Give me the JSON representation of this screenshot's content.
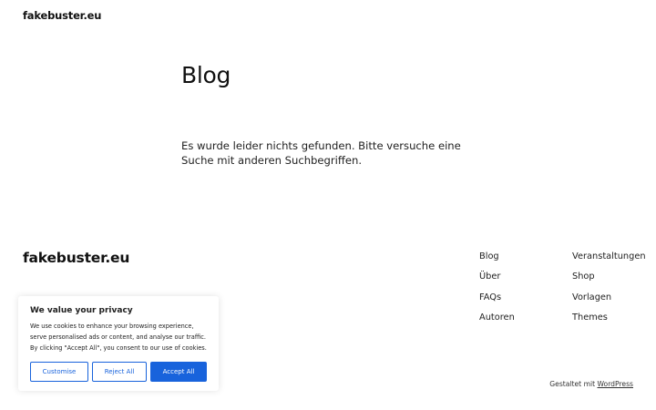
{
  "header": {
    "site_title": "fakebuster.eu"
  },
  "main": {
    "heading": "Blog",
    "notice": "Es wurde leider nichts gefunden. Bitte versuche eine Suche mit anderen Suchbegriffen."
  },
  "footer": {
    "site_title": "fakebuster.eu",
    "nav_col_1": [
      "Blog",
      "Über",
      "FAQs",
      "Autoren"
    ],
    "nav_col_2": [
      "Veranstaltungen",
      "Shop",
      "Vorlagen",
      "Themes"
    ],
    "credit_prefix": "Gestaltet mit",
    "credit_link": "WordPress"
  },
  "cookie_banner": {
    "title": "We value your privacy",
    "text": "We use cookies to enhance your browsing experience, serve personalised ads or content, and analyse our traffic. By clicking \"Accept All\", you consent to our use of cookies.",
    "customise_label": "Customise",
    "reject_label": "Reject All",
    "accept_label": "Accept All",
    "accent_color": "#1863dc"
  }
}
